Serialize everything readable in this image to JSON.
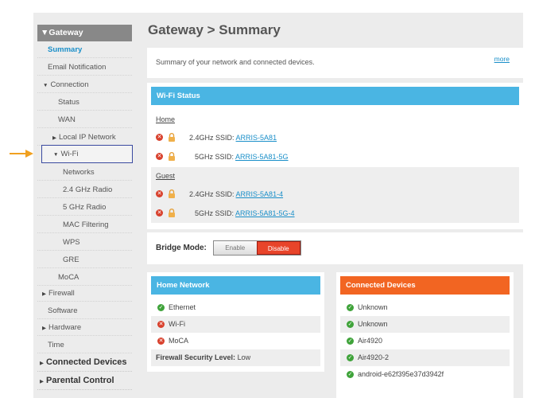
{
  "sidebar": {
    "header": "Gateway",
    "items": [
      {
        "label": "Summary"
      },
      {
        "label": "Email Notification"
      },
      {
        "label": "Connection"
      },
      {
        "label": "Status"
      },
      {
        "label": "WAN"
      },
      {
        "label": "Local IP Network"
      },
      {
        "label": "Wi-Fi"
      },
      {
        "label": "Networks"
      },
      {
        "label": "2.4 GHz Radio"
      },
      {
        "label": "5 GHz Radio"
      },
      {
        "label": "MAC Filtering"
      },
      {
        "label": "WPS"
      },
      {
        "label": "GRE"
      },
      {
        "label": "MoCA"
      },
      {
        "label": "Firewall"
      },
      {
        "label": "Software"
      },
      {
        "label": "Hardware"
      },
      {
        "label": "Time"
      },
      {
        "label": "Connected Devices"
      },
      {
        "label": "Parental Control"
      }
    ]
  },
  "main": {
    "title": "Gateway > Summary",
    "summary_text": "Summary of your network and connected devices.",
    "more_link": "more",
    "wifi_status": {
      "header": "Wi-Fi Status",
      "home_label": "Home",
      "guest_label": "Guest",
      "band_24": "2.4GHz SSID:",
      "band_5": "5GHz SSID:",
      "home_24_ssid": "ARRIS-5A81",
      "home_5_ssid": "ARRIS-5A81-5G",
      "guest_24_ssid": "ARRIS-5A81-4",
      "guest_5_ssid": "ARRIS-5A81-5G-4"
    },
    "bridge_mode": {
      "label": "Bridge Mode:",
      "enable": "Enable",
      "disable": "Disable"
    },
    "home_network": {
      "header": "Home Network",
      "items": [
        "Ethernet",
        "Wi-Fi",
        "MoCA"
      ],
      "firewall_label": "Firewall Security Level:",
      "firewall_value": "Low"
    },
    "connected_devices": {
      "header": "Connected Devices",
      "items": [
        "Unknown",
        "Unknown",
        "Air4920",
        "Air4920-2",
        "android-e62f395e37d3942f"
      ]
    }
  },
  "colors": {
    "wifi_header": "#4ab5e3",
    "home_header": "#4ab5e3",
    "devices_header": "#f26522",
    "accent_link": "#1a8fc9",
    "pointer_arrow": "#f0a020"
  },
  "icons": [
    "chevron-down-icon",
    "chevron-right-icon",
    "error-icon",
    "lock-icon",
    "check-icon",
    "pointer-arrow-icon"
  ]
}
